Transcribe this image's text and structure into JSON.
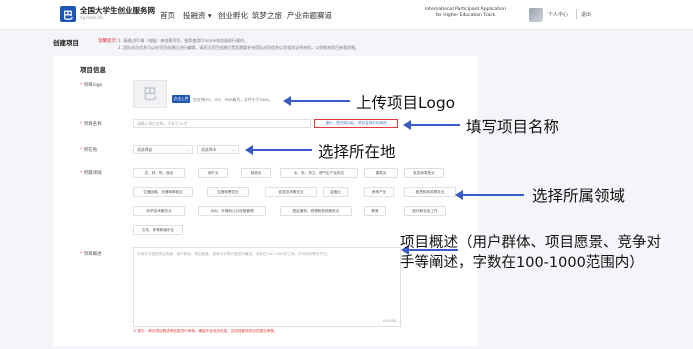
{
  "header": {
    "logo_glyph": "巴",
    "brand": "全国大学生创业服务网",
    "brand_sub": "cy.ncss.cn",
    "nav": [
      "首页",
      "投融资 ▾",
      "创业孵化",
      "筑梦之旅",
      "产业命题赛道"
    ],
    "intl_line1": "International Participant Application",
    "intl_line2": "for Higher Education Track",
    "user": "个人中心",
    "logout": "退出"
  },
  "page": {
    "breadcrumb": "创建项目",
    "tip_title": "温馨提示：",
    "tip1": "1. 请通过PC端（电脑）来创建项目，推荐使用Chrome浏览器进行操作。",
    "tip2": "2. 团队成员信息可以在项目创建后进行编辑，请关注项目创建后是否需要补充团队成员信息以及相关证明材料，以免影响项目参赛资格。"
  },
  "form": {
    "section_title": "项目信息",
    "logo_label": "项目logo",
    "logo_placeholder": "巴",
    "upload_button": "点击上传",
    "upload_hint": "仅支持JPG、GIF、PNG格式，文件小于300k。",
    "name_label": "项目名称",
    "name_placeholder": "请输入项目名称，不多于30字",
    "name_warning": "提示：提交成功后，项目名称不可修改",
    "location_label": "所在地",
    "province_placeholder": "请选择省",
    "city_placeholder": "请选择市",
    "field_label": "所属领域",
    "fields": [
      "农、林、牧、渔业",
      "采矿业",
      "制造业",
      "水、电、热力、燃气生产及供应",
      "建筑业",
      "批发和零售业",
      "交通运输、仓储和邮政业",
      "住宿和餐饮业",
      "信息技术服务业",
      "金融业",
      "房地产业",
      "租赁和商务服务业",
      "科学技术服务业",
      "水利、环境和公共设施管理",
      "居民服务、修理和其他服务业",
      "教育",
      "医疗和社会工作",
      "文化、体育和娱乐业"
    ],
    "summary_label": "项目概述",
    "summary_placeholder": "可用文字描述项目背景、用户群体、项目愿景、竞争对手等方面进行阐述，字数在100-1000字之间，不可填写联系方式。",
    "count": "0/1000",
    "summary_warning": "① 提示：请对项目概述等信息进行审核，确保不含违法信息，否则将影响项目的提交审核。"
  },
  "annotations": {
    "upload_logo": "上传项目Logo",
    "fill_name": "填写项目名称",
    "choose_location": "选择所在地",
    "choose_field": "选择所属领域",
    "summary_line1": "项目概述（用户群体、项目愿景、竞争对",
    "summary_line2": "手等阐述，字数在100-1000范围内）"
  },
  "colors": {
    "brand": "#1f56b3",
    "warning": "#e03a3a",
    "arrow": "#3a5cc6"
  }
}
